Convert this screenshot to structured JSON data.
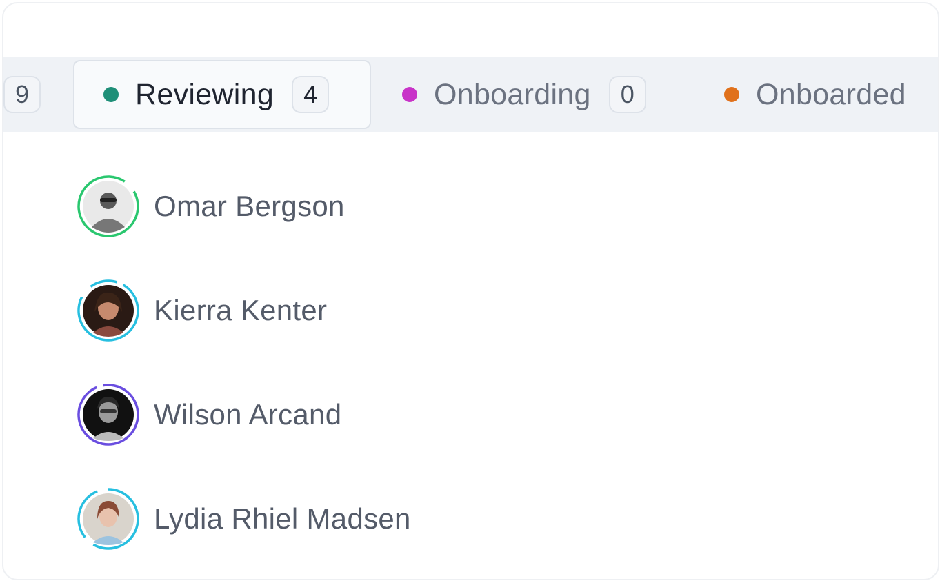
{
  "tabs": [
    {
      "label": "",
      "count": "9",
      "dot_color": "",
      "active": false
    },
    {
      "label": "Reviewing",
      "count": "4",
      "dot_color": "#1f8f78",
      "active": true
    },
    {
      "label": "Onboarding",
      "count": "0",
      "dot_color": "#c833c8",
      "active": false
    },
    {
      "label": "Onboarded",
      "count": "",
      "dot_color": "#e0711b",
      "active": false
    }
  ],
  "people": [
    {
      "name": "Omar Bergson",
      "ring_color": "#2ac76f",
      "avatar": "avatar-photo-icon"
    },
    {
      "name": "Kierra Kenter",
      "ring_color": "#27bfe0",
      "avatar": "avatar-photo-icon"
    },
    {
      "name": "Wilson Arcand",
      "ring_color": "#6a4ee0",
      "avatar": "avatar-photo-icon"
    },
    {
      "name": "Lydia Rhiel Madsen",
      "ring_color": "#27bfe0",
      "avatar": "avatar-photo-icon"
    }
  ]
}
